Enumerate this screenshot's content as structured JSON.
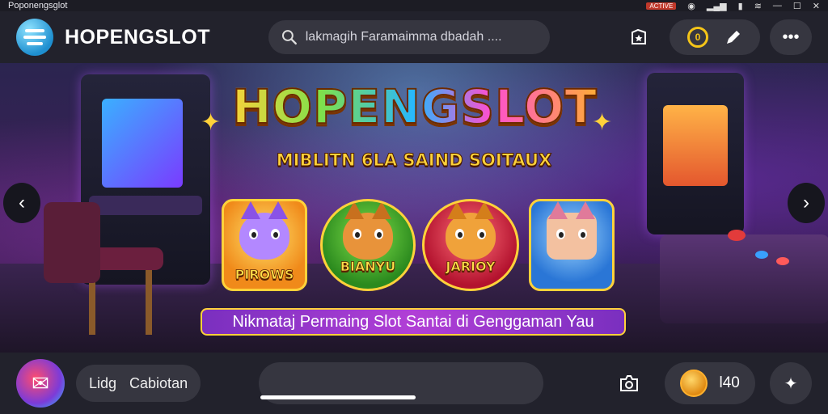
{
  "status_bar": {
    "title": "Poponengsglot",
    "badge": "ACTIVE"
  },
  "header": {
    "brand": "HOPENGSLOT",
    "search_placeholder": "lakmagih Faramaimma dbadah ...."
  },
  "banner": {
    "title": "HOPENGSLOT",
    "subtitle": "MIBLITN 6LA SAIND SOITAUX",
    "cards": [
      {
        "label": "PIROWS"
      },
      {
        "label": "BIANYU"
      },
      {
        "label": "JARIOY"
      },
      {
        "label": ""
      }
    ],
    "tagline": "Nikmataj Permaing Slot Santai di Genggaman Yau"
  },
  "bottom_bar": {
    "chip_left": "Lidg",
    "chip_right": "Cabiotan",
    "coin_count": "l40"
  },
  "colors": {
    "accent_gold": "#ffd23a",
    "accent_purple": "#b13fd6",
    "bar_bg": "#22222c"
  },
  "icons": [
    "search-icon",
    "bookmark-icon",
    "coin-icon",
    "pen-icon",
    "more-icon",
    "chevron-left-icon",
    "chevron-right-icon",
    "camera-icon",
    "sparkle-icon"
  ]
}
